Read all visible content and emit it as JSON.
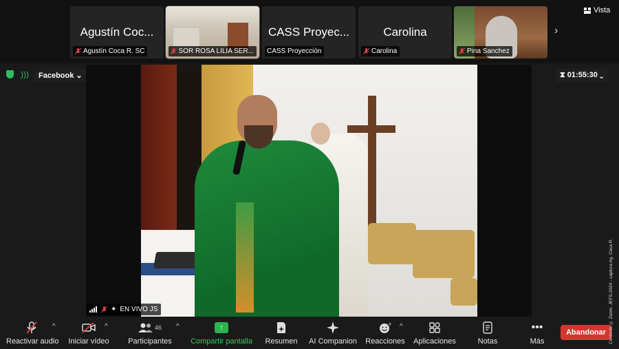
{
  "view": {
    "label": "Vista",
    "icon": "view-grid-icon"
  },
  "gallery": {
    "tiles": [
      {
        "display_name": "Agustín Coc...",
        "tag": "Agustín Coca R. SC",
        "muted": true,
        "video": false
      },
      {
        "display_name": "",
        "tag": "SOR ROSA LILIA SER...",
        "muted": true,
        "video": true
      },
      {
        "display_name": "CASS Proyec...",
        "tag": "CASS Proyección",
        "muted": false,
        "video": false
      },
      {
        "display_name": "Carolina",
        "tag": "Carolina",
        "muted": true,
        "video": false
      },
      {
        "display_name": "",
        "tag": "Pina Sanchez",
        "muted": true,
        "video": true
      }
    ],
    "next_icon": "chevron-right-icon"
  },
  "live": {
    "platform": "Facebook",
    "timer": "01:55:30"
  },
  "stage": {
    "speaker_tag": "EN VIVO JS"
  },
  "toolbar": {
    "items": [
      {
        "label": "Reactivar audio",
        "icon": "mic-muted-icon"
      },
      {
        "label": "Iniciar vídeo",
        "icon": "video-off-icon"
      },
      {
        "label": "Participantes",
        "icon": "participants-icon",
        "count": "46"
      },
      {
        "label": "Compartir pantalla",
        "icon": "share-screen-icon"
      },
      {
        "label": "Resumen",
        "icon": "summary-icon"
      },
      {
        "label": "AI Companion",
        "icon": "sparkle-icon"
      },
      {
        "label": "Reacciones",
        "icon": "reaction-icon"
      },
      {
        "label": "Aplicaciones",
        "icon": "apps-icon"
      },
      {
        "label": "Notas",
        "icon": "notes-icon"
      },
      {
        "label": "Más",
        "icon": "more-icon"
      }
    ],
    "leave": "Abandonar"
  },
  "watermark": "Contexto © Zoom. JEFS-2024 - captura Ag. Coca R.",
  "colors": {
    "share_green": "#2bb34f",
    "leave_red": "#d3362f",
    "vestment_green": "#1f8a3c"
  }
}
